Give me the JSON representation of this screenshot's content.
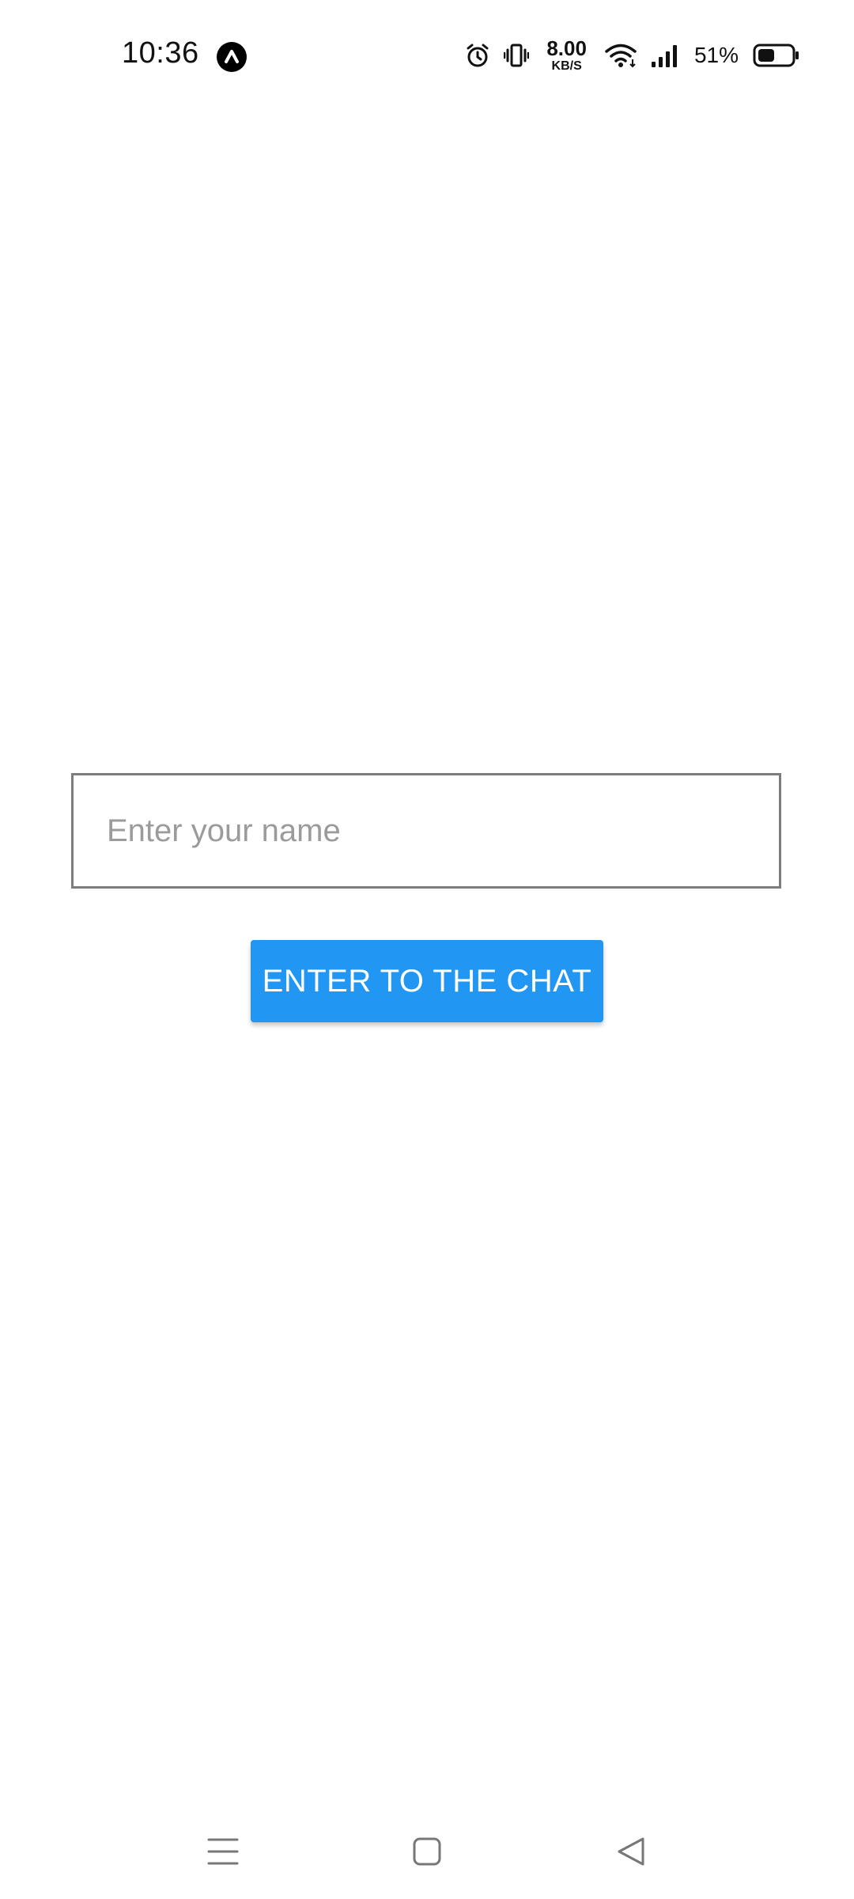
{
  "status_bar": {
    "time": "10:36",
    "app_badge_icon": "caret-up-icon",
    "icons": [
      "alarm-icon",
      "vibrate-icon",
      "wifi-icon",
      "signal-icon",
      "battery-icon"
    ],
    "net_speed_value": "8.00",
    "net_speed_unit": "KB/S",
    "battery_percent": "51%",
    "battery_level": 0.51
  },
  "login": {
    "name_placeholder": "Enter your name",
    "name_value": "",
    "enter_button_label": "ENTER TO THE CHAT",
    "button_color": "#2196f3"
  },
  "nav_bar": {
    "icons": [
      "menu-icon",
      "home-icon",
      "back-icon"
    ]
  }
}
